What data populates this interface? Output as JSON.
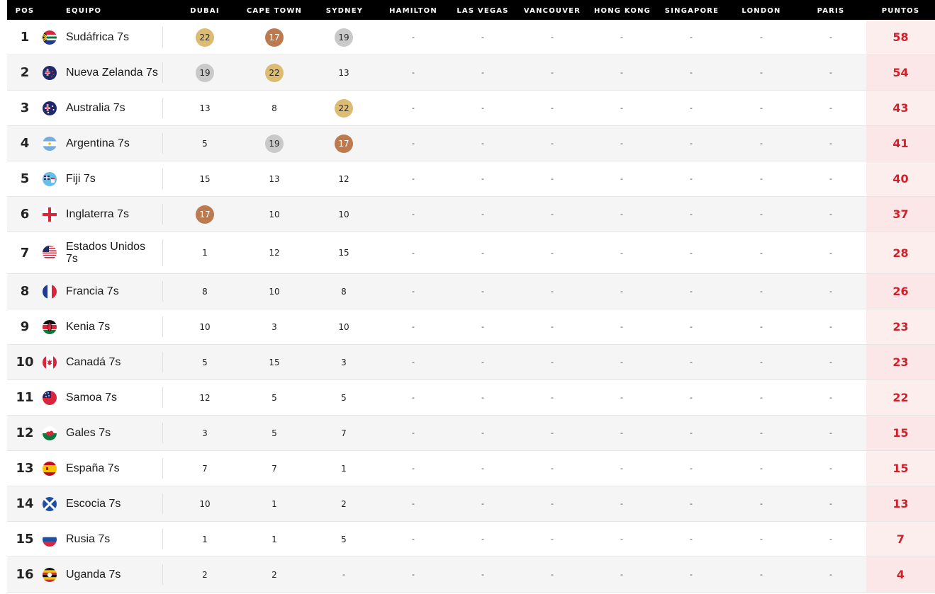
{
  "headers": {
    "pos": "POS",
    "team": "EQUIPO",
    "venues": [
      "DUBAI",
      "CAPE TOWN",
      "SYDNEY",
      "HAMILTON",
      "LAS VEGAS",
      "VANCOUVER",
      "HONG KONG",
      "SINGAPORE",
      "LONDON",
      "PARIS"
    ],
    "points": "PUNTOS"
  },
  "colors": {
    "header_bg": "#000000",
    "points_text": "#d0202a",
    "points_col_bg": "#fdeeee",
    "badge_gold": "#dcbb73",
    "badge_silver": "#c9c9c9",
    "badge_bronze": "#bd7a4f"
  },
  "rows": [
    {
      "pos": "1",
      "team": "Sudáfrica 7s",
      "flag": "south-africa-flag-icon",
      "scores": [
        "22",
        "17",
        "19",
        "-",
        "-",
        "-",
        "-",
        "-",
        "-",
        "-"
      ],
      "medals": [
        "gold",
        "bronze",
        "silver",
        "",
        "",
        "",
        "",
        "",
        "",
        ""
      ],
      "points": "58"
    },
    {
      "pos": "2",
      "team": "Nueva Zelanda 7s",
      "flag": "new-zealand-flag-icon",
      "scores": [
        "19",
        "22",
        "13",
        "-",
        "-",
        "-",
        "-",
        "-",
        "-",
        "-"
      ],
      "medals": [
        "silver",
        "gold",
        "",
        "",
        "",
        "",
        "",
        "",
        "",
        ""
      ],
      "points": "54"
    },
    {
      "pos": "3",
      "team": "Australia 7s",
      "flag": "australia-flag-icon",
      "scores": [
        "13",
        "8",
        "22",
        "-",
        "-",
        "-",
        "-",
        "-",
        "-",
        "-"
      ],
      "medals": [
        "",
        "",
        "gold",
        "",
        "",
        "",
        "",
        "",
        "",
        ""
      ],
      "points": "43"
    },
    {
      "pos": "4",
      "team": "Argentina 7s",
      "flag": "argentina-flag-icon",
      "scores": [
        "5",
        "19",
        "17",
        "-",
        "-",
        "-",
        "-",
        "-",
        "-",
        "-"
      ],
      "medals": [
        "",
        "silver",
        "bronze",
        "",
        "",
        "",
        "",
        "",
        "",
        ""
      ],
      "points": "41"
    },
    {
      "pos": "5",
      "team": "Fiji 7s",
      "flag": "fiji-flag-icon",
      "scores": [
        "15",
        "13",
        "12",
        "-",
        "-",
        "-",
        "-",
        "-",
        "-",
        "-"
      ],
      "medals": [
        "",
        "",
        "",
        "",
        "",
        "",
        "",
        "",
        "",
        ""
      ],
      "points": "40"
    },
    {
      "pos": "6",
      "team": "Inglaterra 7s",
      "flag": "england-flag-icon",
      "scores": [
        "17",
        "10",
        "10",
        "-",
        "-",
        "-",
        "-",
        "-",
        "-",
        "-"
      ],
      "medals": [
        "bronze",
        "",
        "",
        "",
        "",
        "",
        "",
        "",
        "",
        ""
      ],
      "points": "37"
    },
    {
      "pos": "7",
      "team": "Estados Unidos 7s",
      "flag": "usa-flag-icon",
      "scores": [
        "1",
        "12",
        "15",
        "-",
        "-",
        "-",
        "-",
        "-",
        "-",
        "-"
      ],
      "medals": [
        "",
        "",
        "",
        "",
        "",
        "",
        "",
        "",
        "",
        ""
      ],
      "points": "28"
    },
    {
      "pos": "8",
      "team": "Francia 7s",
      "flag": "france-flag-icon",
      "scores": [
        "8",
        "10",
        "8",
        "-",
        "-",
        "-",
        "-",
        "-",
        "-",
        "-"
      ],
      "medals": [
        "",
        "",
        "",
        "",
        "",
        "",
        "",
        "",
        "",
        ""
      ],
      "points": "26"
    },
    {
      "pos": "9",
      "team": "Kenia 7s",
      "flag": "kenya-flag-icon",
      "scores": [
        "10",
        "3",
        "10",
        "-",
        "-",
        "-",
        "-",
        "-",
        "-",
        "-"
      ],
      "medals": [
        "",
        "",
        "",
        "",
        "",
        "",
        "",
        "",
        "",
        ""
      ],
      "points": "23"
    },
    {
      "pos": "10",
      "team": "Canadá 7s",
      "flag": "canada-flag-icon",
      "scores": [
        "5",
        "15",
        "3",
        "-",
        "-",
        "-",
        "-",
        "-",
        "-",
        "-"
      ],
      "medals": [
        "",
        "",
        "",
        "",
        "",
        "",
        "",
        "",
        "",
        ""
      ],
      "points": "23"
    },
    {
      "pos": "11",
      "team": "Samoa 7s",
      "flag": "samoa-flag-icon",
      "scores": [
        "12",
        "5",
        "5",
        "-",
        "-",
        "-",
        "-",
        "-",
        "-",
        "-"
      ],
      "medals": [
        "",
        "",
        "",
        "",
        "",
        "",
        "",
        "",
        "",
        ""
      ],
      "points": "22"
    },
    {
      "pos": "12",
      "team": "Gales 7s",
      "flag": "wales-flag-icon",
      "scores": [
        "3",
        "5",
        "7",
        "-",
        "-",
        "-",
        "-",
        "-",
        "-",
        "-"
      ],
      "medals": [
        "",
        "",
        "",
        "",
        "",
        "",
        "",
        "",
        "",
        ""
      ],
      "points": "15"
    },
    {
      "pos": "13",
      "team": "España 7s",
      "flag": "spain-flag-icon",
      "scores": [
        "7",
        "7",
        "1",
        "-",
        "-",
        "-",
        "-",
        "-",
        "-",
        "-"
      ],
      "medals": [
        "",
        "",
        "",
        "",
        "",
        "",
        "",
        "",
        "",
        ""
      ],
      "points": "15"
    },
    {
      "pos": "14",
      "team": "Escocia 7s",
      "flag": "scotland-flag-icon",
      "scores": [
        "10",
        "1",
        "2",
        "-",
        "-",
        "-",
        "-",
        "-",
        "-",
        "-"
      ],
      "medals": [
        "",
        "",
        "",
        "",
        "",
        "",
        "",
        "",
        "",
        ""
      ],
      "points": "13"
    },
    {
      "pos": "15",
      "team": "Rusia 7s",
      "flag": "russia-flag-icon",
      "scores": [
        "1",
        "1",
        "5",
        "-",
        "-",
        "-",
        "-",
        "-",
        "-",
        "-"
      ],
      "medals": [
        "",
        "",
        "",
        "",
        "",
        "",
        "",
        "",
        "",
        ""
      ],
      "points": "7"
    },
    {
      "pos": "16",
      "team": "Uganda 7s",
      "flag": "uganda-flag-icon",
      "scores": [
        "2",
        "2",
        "-",
        "-",
        "-",
        "-",
        "-",
        "-",
        "-",
        "-"
      ],
      "medals": [
        "",
        "",
        "",
        "",
        "",
        "",
        "",
        "",
        "",
        ""
      ],
      "points": "4"
    }
  ]
}
